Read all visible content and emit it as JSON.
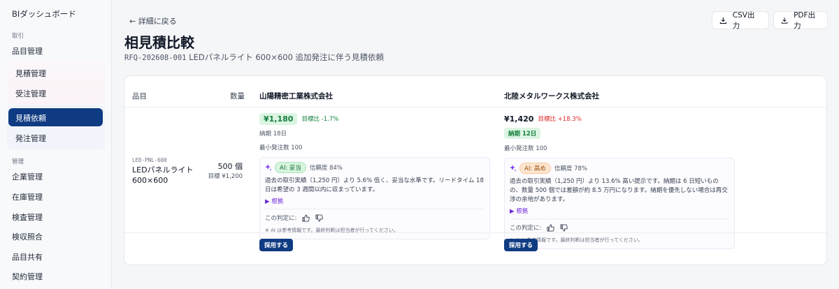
{
  "sidebar": {
    "brand": "BIダッシュボード",
    "section_trade": "取引",
    "item_master": "品目管理",
    "sub_quote": "見積管理",
    "sub_order_recv": "受注管理",
    "sub_rfq": "見積依頼",
    "sub_order_place": "発注管理",
    "section_manage": "管理",
    "items": [
      "企業管理",
      "在庫管理",
      "検査管理",
      "検収照合",
      "品目共有",
      "契約管理"
    ]
  },
  "header": {
    "back": "← 詳細に戻る",
    "title": "相見積比較",
    "code": "RFQ-202608-001",
    "desc": "LEDパネルライト 600×600 追加発注に伴う見積依頼",
    "csv": "CSV出力",
    "pdf": "PDF出力"
  },
  "table": {
    "col_item": "品目",
    "col_qty": "数量",
    "item": {
      "sku": "LED-PNL-600",
      "name": "LEDパネルライト 600×600",
      "qty": "500 個",
      "target": "目標 ¥1,200"
    },
    "suppliers": [
      {
        "name": "山陽精密工業株式会社",
        "price": "¥1,180",
        "delta": "目標比 -1.7%",
        "lead": "納期 18日",
        "moq": "最小発注数 100",
        "ai_label": "AI: 妥当",
        "confidence": "信頼度 84%",
        "ai_text": "過去の取引実績（1,250 円）より 5.6% 低く、妥当な水準です。リードタイム 18 日は希望の 3 週間以内に収まっています。",
        "basis": "▶ 根拠",
        "judge": "この判定に:",
        "note": "※ AI は参考情報です。最終判断は担当者が行ってください。",
        "adopt": "採用する"
      },
      {
        "name": "北陸メタルワークス株式会社",
        "price": "¥1,420",
        "delta": "目標比 +18.3%",
        "lead": "納期 12日",
        "moq": "最小発注数 100",
        "ai_label": "AI: 高め",
        "confidence": "信頼度 78%",
        "ai_text": "過去の取引実績（1,250 円）より 13.6% 高い提示です。納期は 6 日短いものの、数量 500 個では差額が約 8.5 万円になります。納期を優先しない場合は再交渉の余地があります。",
        "basis": "▶ 根拠",
        "judge": "この判定に:",
        "note": "※ AI は参考情報です。最終判断は担当者が行ってください。",
        "adopt": "採用する"
      }
    ]
  },
  "colors": {
    "primary": "#0f3b82",
    "good": "#15803d",
    "bad": "#dc2626",
    "ai": "#7c3aed"
  }
}
